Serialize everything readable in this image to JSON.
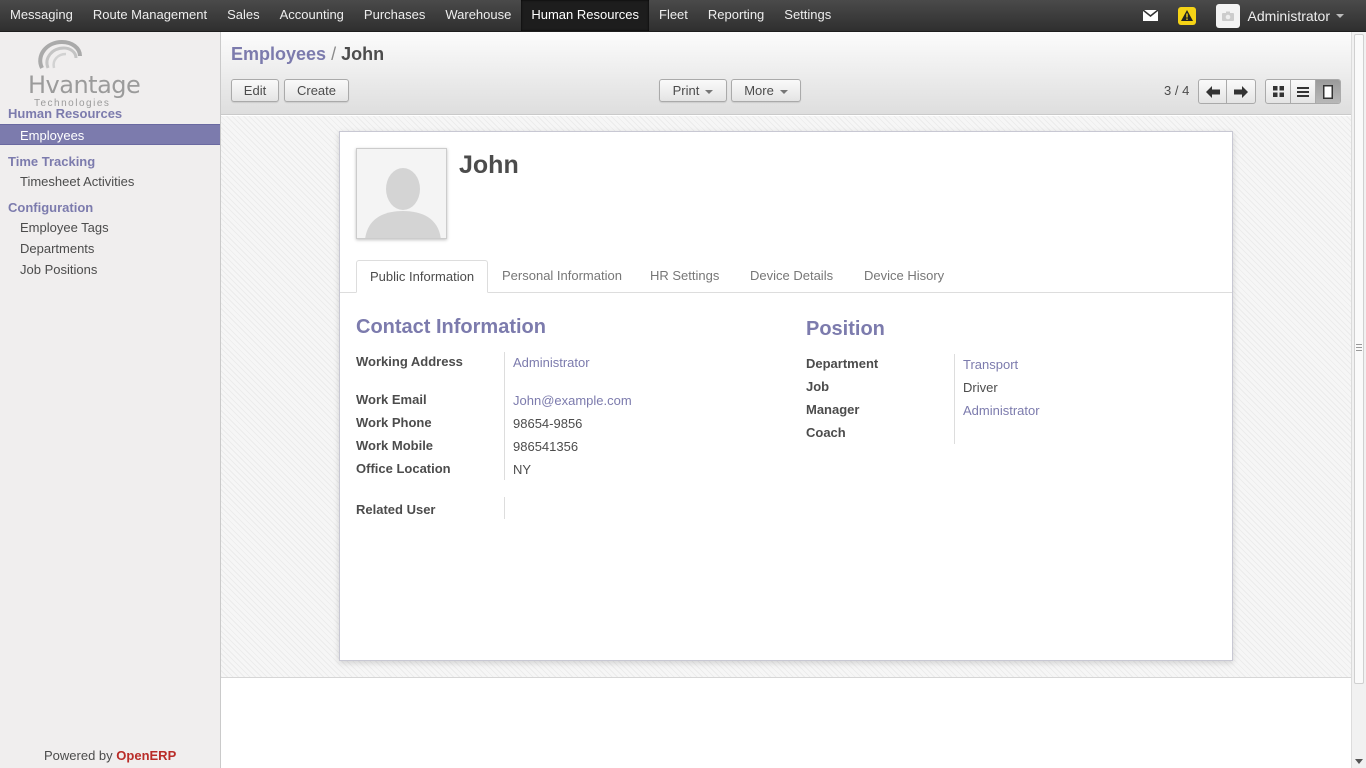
{
  "topbar": {
    "menu": [
      "Messaging",
      "Route Management",
      "Sales",
      "Accounting",
      "Purchases",
      "Warehouse",
      "Human Resources",
      "Fleet",
      "Reporting",
      "Settings"
    ],
    "active_menu": "Human Resources",
    "user_name": "Administrator",
    "icons": [
      "envelope-icon",
      "warning-icon",
      "avatar"
    ]
  },
  "sidebar": {
    "logo_text": "Hvantage",
    "logo_sub": "Technologies",
    "sections": [
      {
        "title": "Human Resources",
        "items": [
          "Employees"
        ]
      },
      {
        "title": "Time Tracking",
        "items": [
          "Timesheet Activities"
        ]
      },
      {
        "title": "Configuration",
        "items": [
          "Employee Tags",
          "Departments",
          "Job Positions"
        ]
      }
    ],
    "active_item": "Employees",
    "powered_by": "Powered by",
    "powered_brand": "OpenERP"
  },
  "header": {
    "breadcrumb_parent": "Employees",
    "breadcrumb_sep": "/",
    "breadcrumb_current": "John",
    "buttons": {
      "edit": "Edit",
      "create": "Create",
      "print": "Print",
      "more": "More"
    },
    "pager": "3 / 4"
  },
  "employee": {
    "name": "John",
    "tabs": [
      "Public Information",
      "Personal Information",
      "HR Settings",
      "Device Details",
      "Device Hisory"
    ],
    "active_tab": "Public Information",
    "contact": {
      "title": "Contact Information",
      "working_address_label": "Working Address",
      "working_address": "Administrator",
      "work_email_label": "Work Email",
      "work_email": "John@example.com",
      "work_phone_label": "Work Phone",
      "work_phone": "98654-9856",
      "work_mobile_label": "Work Mobile",
      "work_mobile": "986541356",
      "office_location_label": "Office Location",
      "office_location": "NY",
      "related_user_label": "Related User",
      "related_user": ""
    },
    "position": {
      "title": "Position",
      "department_label": "Department",
      "department": "Transport",
      "job_label": "Job",
      "job": "Driver",
      "manager_label": "Manager",
      "manager": "Administrator",
      "coach_label": "Coach",
      "coach": ""
    }
  },
  "colors": {
    "accent": "#7c7bad",
    "brand_red": "#b92c28",
    "warning": "#f5d316"
  }
}
